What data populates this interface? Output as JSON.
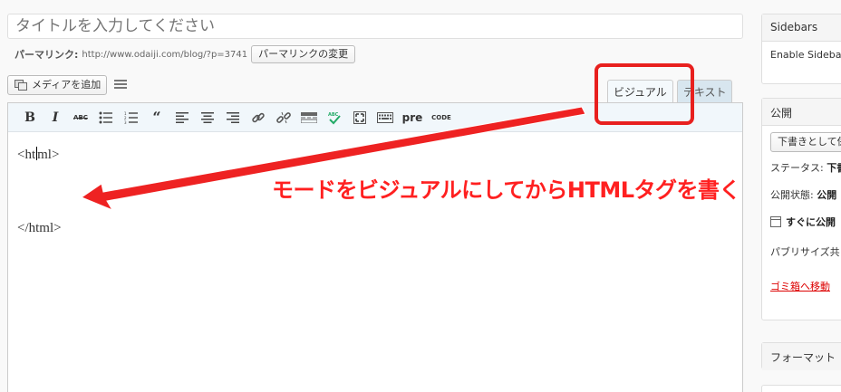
{
  "post": {
    "title_placeholder": "タイトルを入力してください",
    "permalink_label": "パーマリンク:",
    "permalink_url": "http://www.odaiji.com/blog/?p=3741",
    "permalink_button": "パーマリンクの変更"
  },
  "editor": {
    "add_media": "メディアを追加",
    "tab_visual": "ビジュアル",
    "tab_text": "テキスト",
    "toolbar": {
      "bold": "B",
      "italic": "I",
      "strike": "ABC",
      "quote": "“",
      "pre": "pre",
      "code": "CODE"
    },
    "content_open_before": "<ht",
    "content_open_after": "ml>",
    "content_close": "</html>"
  },
  "annotation": {
    "text": "モードをビジュアルにしてからHTMLタグを書く",
    "color": "#ff2020"
  },
  "sidebar": {
    "sidebars_title": "Sidebars",
    "sidebars_enable": "Enable Sidebar:",
    "publish_title": "公開",
    "save_draft": "下書きとして保",
    "status_label": "ステータス:",
    "status_value": "下書",
    "visibility_label": "公開状態:",
    "visibility_value": "公開",
    "schedule_value": "すぐに公開",
    "publicize": "パブリサイズ共",
    "trash": "ゴミ箱へ移動",
    "format_title": "フォーマット"
  }
}
